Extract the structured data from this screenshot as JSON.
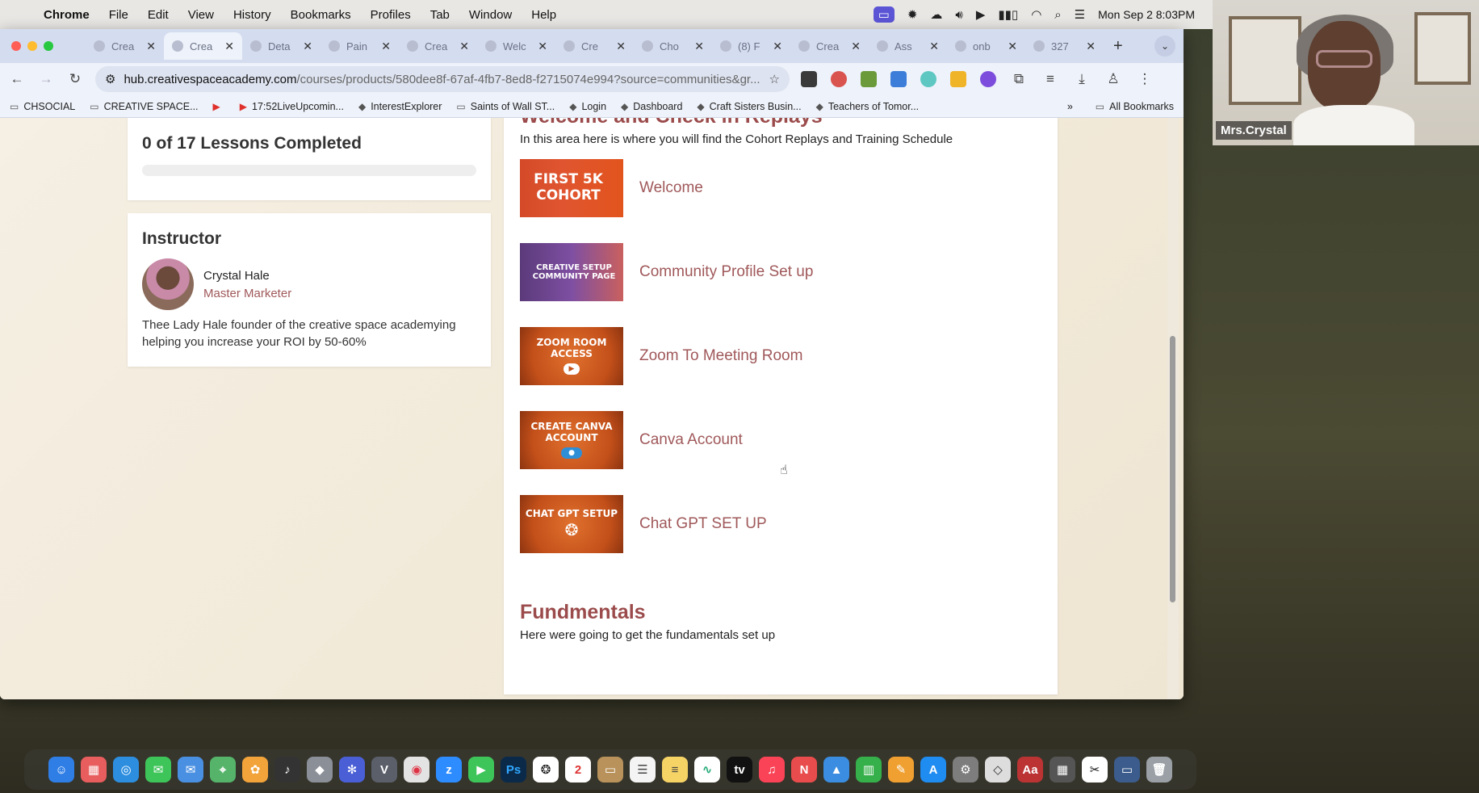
{
  "menubar": {
    "app": "Chrome",
    "items": [
      "File",
      "Edit",
      "View",
      "History",
      "Bookmarks",
      "Profiles",
      "Tab",
      "Window",
      "Help"
    ],
    "clock": "Mon Sep 2  8:03PM"
  },
  "tabs": [
    {
      "title": "Crea",
      "active": false
    },
    {
      "title": "Crea",
      "active": true
    },
    {
      "title": "Deta",
      "active": false
    },
    {
      "title": "Pain",
      "active": false
    },
    {
      "title": "Crea",
      "active": false
    },
    {
      "title": "Welc",
      "active": false
    },
    {
      "title": "Cre",
      "active": false
    },
    {
      "title": "Cho",
      "active": false
    },
    {
      "title": "(8) F",
      "active": false
    },
    {
      "title": "Crea",
      "active": false
    },
    {
      "title": "Ass",
      "active": false
    },
    {
      "title": "onb",
      "active": false
    },
    {
      "title": "327",
      "active": false
    }
  ],
  "toolbar": {
    "url_host": "hub.creativespaceacademy.com",
    "url_path": "/courses/products/580dee8f-67af-4fb7-8ed8-f2715074e994?source=communities&gr..."
  },
  "bookmarks": [
    {
      "label": "CHSOCIAL",
      "icon": "folder-icon"
    },
    {
      "label": "CREATIVE SPACE...",
      "icon": "folder-icon"
    },
    {
      "label": "",
      "icon": "youtube-icon"
    },
    {
      "label": "17:52LiveUpcomin...",
      "icon": "youtube-icon"
    },
    {
      "label": "InterestExplorer",
      "icon": "bookmark-icon"
    },
    {
      "label": "Saints of Wall ST...",
      "icon": "folder-icon"
    },
    {
      "label": "Login",
      "icon": "bookmark-icon"
    },
    {
      "label": "Dashboard",
      "icon": "bookmark-icon"
    },
    {
      "label": "Craft Sisters Busin...",
      "icon": "bookmark-icon"
    },
    {
      "label": "Teachers of Tomor...",
      "icon": "bookmark-icon"
    }
  ],
  "bookmarks_overflow": "»",
  "all_bookmarks": "All Bookmarks",
  "progress": {
    "text": "0 of 17 Lessons Completed",
    "fraction": 0
  },
  "instructor": {
    "heading": "Instructor",
    "name": "Crystal Hale",
    "title": "Master Marketer",
    "bio": "Thee Lady Hale founder of the creative space academying helping you increase your ROI by 50-60%"
  },
  "section1": {
    "title": "Welcome and Check in Replays",
    "subtitle": "In this area here is where you will find the Cohort Replays and Training Schedule",
    "lessons": [
      {
        "title": "Welcome",
        "thumb_text": "FIRST 5K COHORT"
      },
      {
        "title": "Community Profile Set up",
        "thumb_text": "CREATIVE SETUP COMMUNITY PAGE"
      },
      {
        "title": "Zoom To Meeting Room",
        "thumb_text": "ZOOM ROOM ACCESS"
      },
      {
        "title": "Canva Account",
        "thumb_text": "CREATE CANVA ACCOUNT"
      },
      {
        "title": "Chat GPT SET UP",
        "thumb_text": "CHAT GPT SETUP"
      }
    ]
  },
  "section2": {
    "title": "Fundmentals",
    "subtitle": "Here were going to get the fundamentals set up"
  },
  "video": {
    "name": "Mrs.Crystal"
  },
  "colors": {
    "accent": "#9b4b4b",
    "lesson_link": "#a0585a",
    "thumb_orange": "#c4501a"
  }
}
